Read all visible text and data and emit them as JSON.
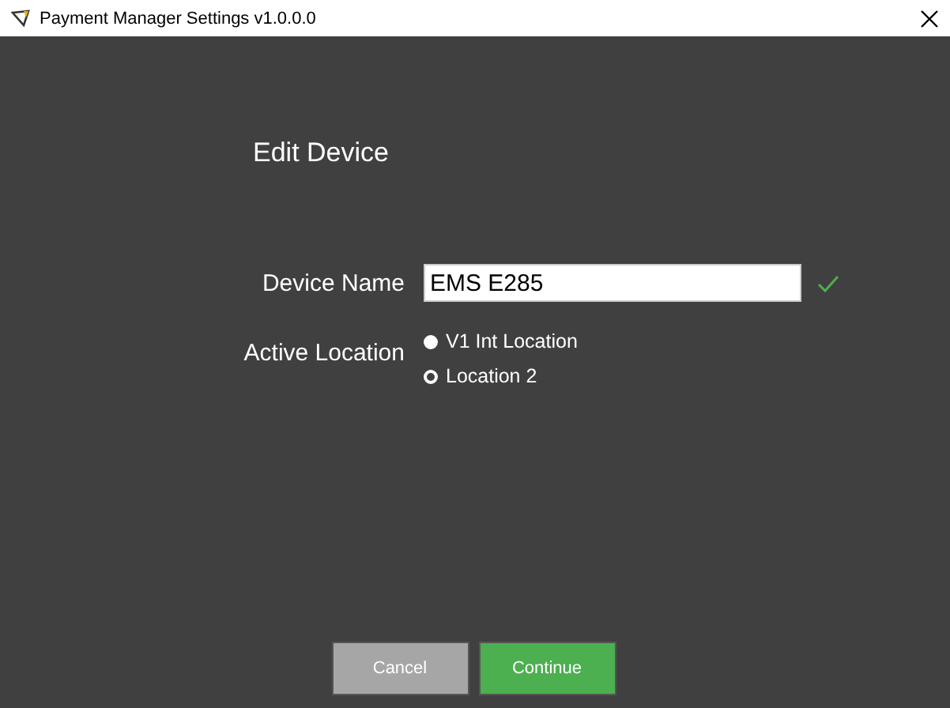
{
  "window": {
    "title": "Payment Manager Settings v1.0.0.0"
  },
  "heading": "Edit Device",
  "device_name": {
    "label": "Device Name",
    "value": "EMS E285",
    "valid": true
  },
  "active_location": {
    "label": "Active Location",
    "options": [
      {
        "label": "V1 Int Location",
        "selected": false
      },
      {
        "label": "Location 2",
        "selected": true
      }
    ]
  },
  "buttons": [
    {
      "label": "Cancel",
      "kind": "secondary"
    },
    {
      "label": "Continue",
      "kind": "primary"
    }
  ]
}
